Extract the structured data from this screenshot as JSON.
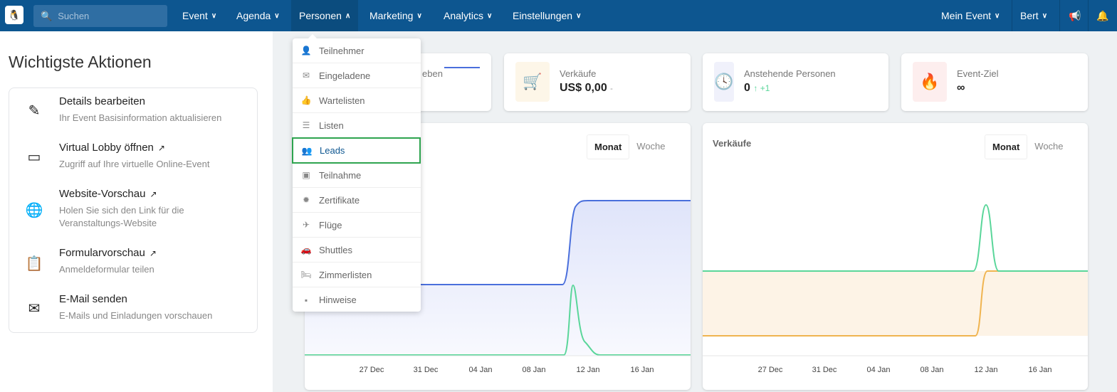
{
  "nav": {
    "search_placeholder": "Suchen",
    "items": [
      {
        "label": "Event"
      },
      {
        "label": "Agenda"
      },
      {
        "label": "Personen"
      },
      {
        "label": "Marketing"
      },
      {
        "label": "Analytics"
      },
      {
        "label": "Einstellungen"
      }
    ],
    "right": [
      {
        "label": "Mein Event"
      },
      {
        "label": "Bert"
      }
    ]
  },
  "left": {
    "title": "Wichtigste Aktionen",
    "actions": [
      {
        "title": "Details bearbeiten",
        "subtitle": "Ihr Event Basisinformation aktualisieren",
        "icon": "pencil-icon"
      },
      {
        "title": "Virtual Lobby öffnen",
        "subtitle": "Zugriff auf Ihre virtuelle Online-Event",
        "icon": "video-camera-icon"
      },
      {
        "title": "Website-Vorschau",
        "subtitle": "Holen Sie sich den Link für die Veranstaltungs-Website",
        "icon": "globe-icon"
      },
      {
        "title": "Formularvorschau",
        "subtitle": "Anmeldeformular teilen",
        "icon": "clipboard-icon"
      },
      {
        "title": "E-Mail senden",
        "subtitle": "E-Mails und Einladungen vorschauen",
        "icon": "envelope-icon"
      }
    ]
  },
  "stats": [
    {
      "label_partial": "eben"
    },
    {
      "label": "Verkäufe",
      "value": "US$ 0,00",
      "suffix": "-",
      "color": "#f0ad4e"
    },
    {
      "label": "Anstehende Personen",
      "value": "0",
      "delta": "↑ +1",
      "color": "#7b7fd4"
    },
    {
      "label": "Event-Ziel",
      "value": "∞",
      "color": "#f0616e"
    }
  ],
  "charts": [
    {
      "title": "",
      "tabs": [
        "Monat",
        "Woche"
      ],
      "active_tab": "Monat",
      "xticks": [
        "27 Dec",
        "31 Dec",
        "04 Jan",
        "08 Jan",
        "12 Jan",
        "16 Jan"
      ]
    },
    {
      "title": "Verkäufe",
      "tabs": [
        "Monat",
        "Woche"
      ],
      "active_tab": "Monat",
      "xticks": [
        "27 Dec",
        "31 Dec",
        "04 Jan",
        "08 Jan",
        "12 Jan",
        "16 Jan"
      ]
    }
  ],
  "dropdown": {
    "selected": "Leads",
    "items": [
      {
        "label": "Teilnehmer",
        "icon": "user-icon"
      },
      {
        "label": "Eingeladene",
        "icon": "envelope-icon"
      },
      {
        "label": "Wartelisten",
        "icon": "thumbs-up-icon"
      },
      {
        "label": "Listen",
        "icon": "list-icon"
      },
      {
        "label": "Leads",
        "icon": "users-icon"
      },
      {
        "label": "Teilnahme",
        "icon": "presentation-icon"
      },
      {
        "label": "Zertifikate",
        "icon": "certificate-icon"
      },
      {
        "label": "Flüge",
        "icon": "plane-icon"
      },
      {
        "label": "Shuttles",
        "icon": "car-icon"
      },
      {
        "label": "Zimmerlisten",
        "icon": "bed-icon"
      },
      {
        "label": "Hinweise",
        "icon": "note-icon"
      }
    ]
  },
  "colors": {
    "nav": "#0d5690",
    "blue_series": "#4a6fdc",
    "green_series": "#5ad69a",
    "orange_series": "#f0b450",
    "selected_border": "#2ea44f"
  }
}
